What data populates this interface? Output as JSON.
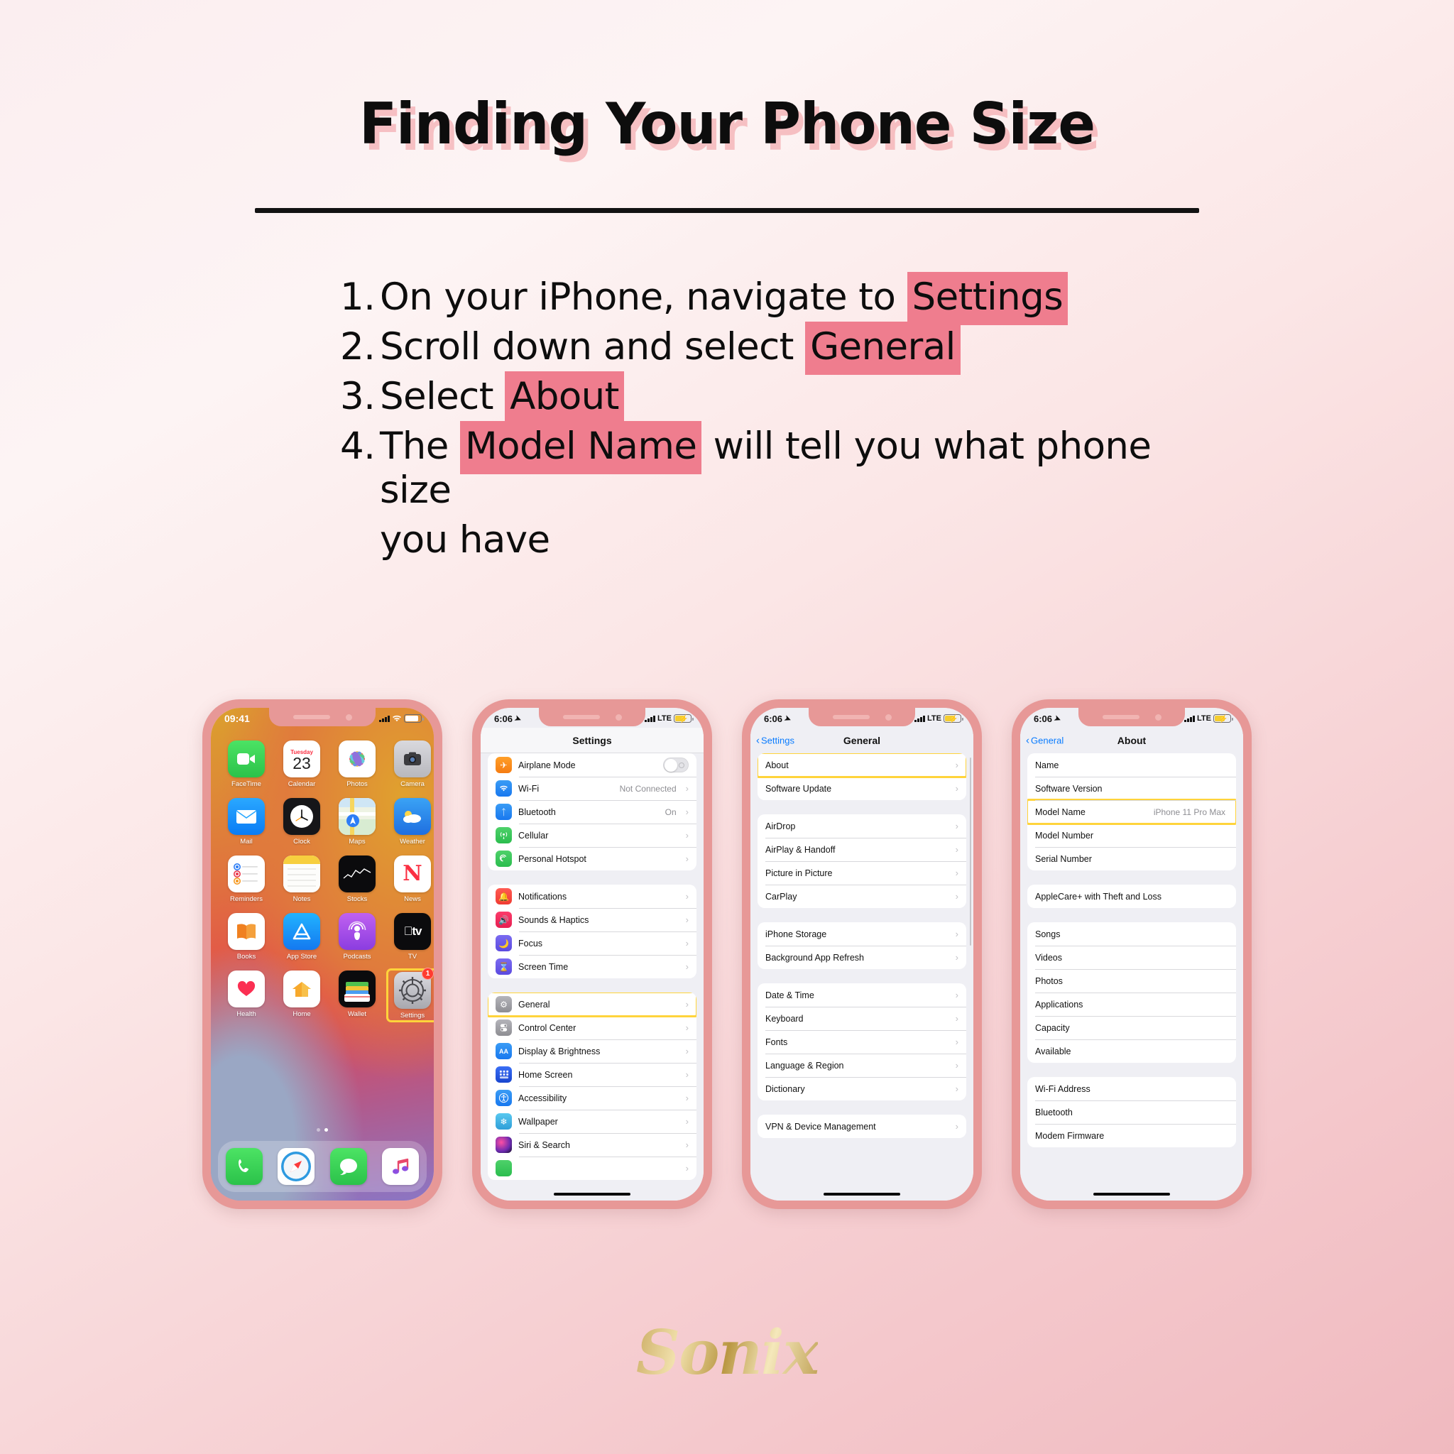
{
  "title": "Finding Your Phone Size",
  "steps": [
    {
      "num": "1.",
      "pre": "On your iPhone, navigate to ",
      "highlight": "Settings",
      "post": ""
    },
    {
      "num": "2.",
      "pre": "Scroll down and select ",
      "highlight": "General",
      "post": ""
    },
    {
      "num": "3.",
      "pre": "Select ",
      "highlight": "About",
      "post": ""
    },
    {
      "num": "4.",
      "pre": "The ",
      "highlight": "Model Name",
      "post": " will tell you what phone size",
      "cont": "you have"
    }
  ],
  "colors": {
    "highlight_pink": "#ef7d8e",
    "focus_yellow": "#ffd43b",
    "ios_blue": "#0a7cff",
    "phone_body": "#e79897"
  },
  "phones": [
    {
      "name": "home-screen",
      "status": {
        "time": "09:41",
        "location_icon": "location-arrow-icon",
        "carrier": "",
        "signal": "signal-bars-icon",
        "battery": "battery-icon"
      },
      "apps": [
        {
          "label": "FaceTime",
          "icon": "facetime-icon"
        },
        {
          "label": "Calendar",
          "icon": "calendar-icon",
          "weekday": "Tuesday",
          "day": "23"
        },
        {
          "label": "Photos",
          "icon": "photos-icon"
        },
        {
          "label": "Camera",
          "icon": "camera-icon"
        },
        {
          "label": "Mail",
          "icon": "mail-icon"
        },
        {
          "label": "Clock",
          "icon": "clock-icon"
        },
        {
          "label": "Maps",
          "icon": "maps-icon"
        },
        {
          "label": "Weather",
          "icon": "weather-icon"
        },
        {
          "label": "Reminders",
          "icon": "reminders-icon"
        },
        {
          "label": "Notes",
          "icon": "notes-icon"
        },
        {
          "label": "Stocks",
          "icon": "stocks-icon"
        },
        {
          "label": "News",
          "icon": "news-icon"
        },
        {
          "label": "Books",
          "icon": "books-icon"
        },
        {
          "label": "App Store",
          "icon": "app-store-icon"
        },
        {
          "label": "Podcasts",
          "icon": "podcasts-icon"
        },
        {
          "label": "TV",
          "icon": "tv-icon"
        },
        {
          "label": "Health",
          "icon": "health-icon"
        },
        {
          "label": "Home",
          "icon": "home-icon"
        },
        {
          "label": "Wallet",
          "icon": "wallet-icon"
        },
        {
          "label": "Settings",
          "icon": "settings-gear-icon",
          "badge": "1",
          "selected": true
        }
      ],
      "dock": [
        {
          "label": "Phone",
          "icon": "phone-icon"
        },
        {
          "label": "Safari",
          "icon": "safari-icon"
        },
        {
          "label": "Messages",
          "icon": "messages-icon"
        },
        {
          "label": "Music",
          "icon": "music-icon"
        }
      ],
      "page_dots": 2,
      "active_dot": 1
    },
    {
      "name": "settings-screen",
      "status": {
        "time": "6:06",
        "carrier": "LTE"
      },
      "nav_title": "Settings",
      "groups": [
        [
          {
            "label": "Airplane Mode",
            "icon": "airplane-icon",
            "control": "toggle",
            "on": false
          },
          {
            "label": "Wi-Fi",
            "icon": "wifi-icon",
            "value": "Not Connected",
            "chevron": true
          },
          {
            "label": "Bluetooth",
            "icon": "bluetooth-icon",
            "value": "On",
            "chevron": true
          },
          {
            "label": "Cellular",
            "icon": "cellular-icon",
            "chevron": true
          },
          {
            "label": "Personal Hotspot",
            "icon": "hotspot-icon",
            "chevron": true
          }
        ],
        [
          {
            "label": "Notifications",
            "icon": "notifications-bell-icon",
            "chevron": true
          },
          {
            "label": "Sounds & Haptics",
            "icon": "sounds-icon",
            "chevron": true
          },
          {
            "label": "Focus",
            "icon": "focus-moon-icon",
            "chevron": true
          },
          {
            "label": "Screen Time",
            "icon": "screen-time-icon",
            "chevron": true
          }
        ],
        [
          {
            "label": "General",
            "icon": "general-gear-icon",
            "chevron": true,
            "highlighted": true
          },
          {
            "label": "Control Center",
            "icon": "control-center-icon",
            "chevron": true
          },
          {
            "label": "Display & Brightness",
            "icon": "display-aa-icon",
            "chevron": true
          },
          {
            "label": "Home Screen",
            "icon": "home-screen-icon",
            "chevron": true
          },
          {
            "label": "Accessibility",
            "icon": "accessibility-icon",
            "chevron": true
          },
          {
            "label": "Wallpaper",
            "icon": "wallpaper-icon",
            "chevron": true
          },
          {
            "label": "Siri & Search",
            "icon": "siri-icon",
            "chevron": true
          }
        ]
      ]
    },
    {
      "name": "general-screen",
      "status": {
        "time": "6:06",
        "carrier": "LTE"
      },
      "back_label": "Settings",
      "nav_title": "General",
      "groups": [
        [
          {
            "label": "About",
            "chevron": true,
            "highlighted": true
          },
          {
            "label": "Software Update",
            "chevron": true
          }
        ],
        [
          {
            "label": "AirDrop",
            "chevron": true
          },
          {
            "label": "AirPlay & Handoff",
            "chevron": true
          },
          {
            "label": "Picture in Picture",
            "chevron": true
          },
          {
            "label": "CarPlay",
            "chevron": true
          }
        ],
        [
          {
            "label": "iPhone Storage",
            "chevron": true
          },
          {
            "label": "Background App Refresh",
            "chevron": true
          }
        ],
        [
          {
            "label": "Date & Time",
            "chevron": true
          },
          {
            "label": "Keyboard",
            "chevron": true
          },
          {
            "label": "Fonts",
            "chevron": true
          },
          {
            "label": "Language & Region",
            "chevron": true
          },
          {
            "label": "Dictionary",
            "chevron": true
          }
        ],
        [
          {
            "label": "VPN & Device Management",
            "chevron": true
          }
        ]
      ]
    },
    {
      "name": "about-screen",
      "status": {
        "time": "6:06",
        "carrier": "LTE"
      },
      "back_label": "General",
      "nav_title": "About",
      "groups": [
        [
          {
            "label": "Name"
          },
          {
            "label": "Software Version"
          },
          {
            "label": "Model Name",
            "value": "iPhone 11 Pro Max",
            "highlighted": true
          },
          {
            "label": "Model Number"
          },
          {
            "label": "Serial Number"
          }
        ],
        [
          {
            "label": "AppleCare+ with Theft and Loss"
          }
        ],
        [
          {
            "label": "Songs"
          },
          {
            "label": "Videos"
          },
          {
            "label": "Photos"
          },
          {
            "label": "Applications"
          },
          {
            "label": "Capacity"
          },
          {
            "label": "Available"
          }
        ],
        [
          {
            "label": "Wi-Fi Address"
          },
          {
            "label": "Bluetooth"
          },
          {
            "label": "Modem Firmware"
          }
        ]
      ]
    }
  ],
  "footer": {
    "brand": "Sonix"
  }
}
